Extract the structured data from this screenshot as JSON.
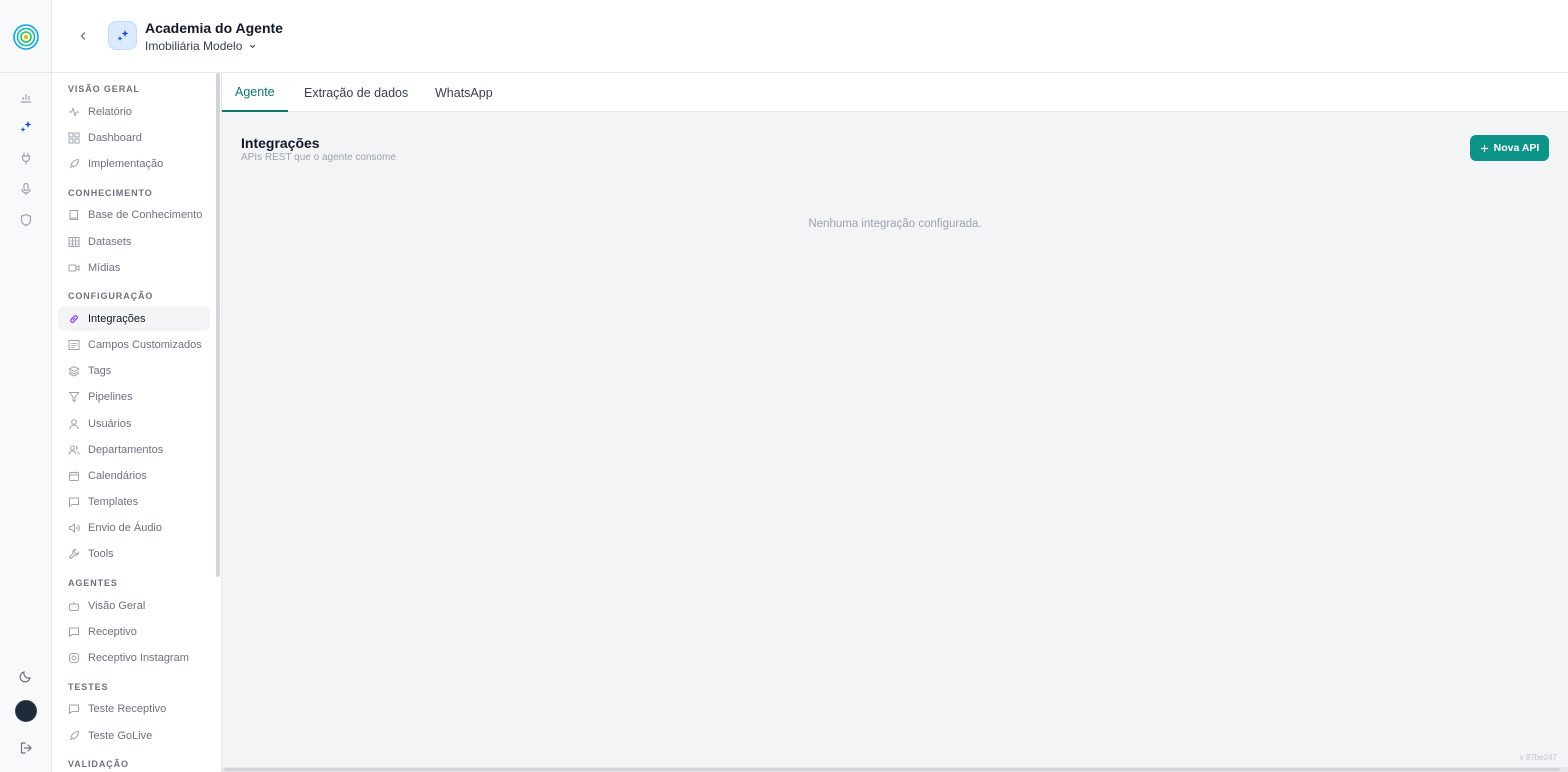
{
  "header": {
    "agent_name": "Academia do Agente",
    "org_name": "Imobiliária Modelo"
  },
  "sidebar": {
    "sections": [
      {
        "label": "Visão Geral",
        "items": [
          "Relatório",
          "Dashboard",
          "Implementação"
        ]
      },
      {
        "label": "Conhecimento",
        "items": [
          "Base de Conhecimento",
          "Datasets",
          "Mídias"
        ]
      },
      {
        "label": "Configuração",
        "items": [
          "Integrações",
          "Campos Customizados",
          "Tags",
          "Pipelines",
          "Usuários",
          "Departamentos",
          "Calendários",
          "Templates",
          "Envio de Áudio",
          "Tools"
        ]
      },
      {
        "label": "Agentes",
        "items": [
          "Visão Geral",
          "Receptivo",
          "Receptivo Instagram"
        ]
      },
      {
        "label": "Testes",
        "items": [
          "Teste Receptivo",
          "Teste GoLive"
        ]
      },
      {
        "label": "Validação",
        "items": []
      }
    ],
    "active_item": "Integrações"
  },
  "tabs": [
    "Agente",
    "Extração de dados",
    "WhatsApp"
  ],
  "active_tab": "Agente",
  "main": {
    "title": "Integrações",
    "subtitle": "APIs REST que o agente consome",
    "new_button_label": "Nova API",
    "empty_message": "Nenhuma integração configurada.",
    "version": "v 87be247"
  },
  "colors": {
    "accent": "#0d9488",
    "active_tab": "#0f766e",
    "active_icon": "#7c3aed",
    "brand_blue": "#1d4ed8"
  }
}
